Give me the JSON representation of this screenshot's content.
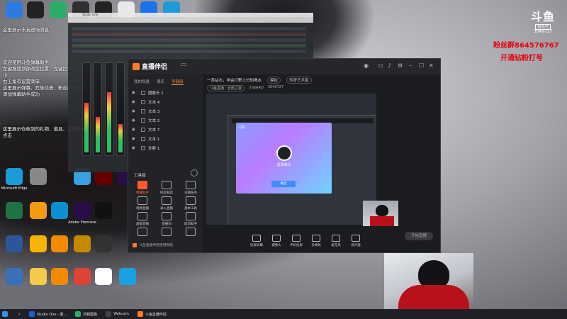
{
  "desktop": {
    "icons": [
      {
        "label": "",
        "icon": "tencent-desktop-icon",
        "color": "#2d7be0"
      },
      {
        "label": "",
        "icon": "audio-meter-icon",
        "color": "#222"
      },
      {
        "label": "",
        "icon": "wechat-icon",
        "color": "#2aae67"
      },
      {
        "label": "",
        "icon": "obs-icon",
        "color": "#303030"
      },
      {
        "label": "",
        "icon": "capcut-icon",
        "color": "#222"
      },
      {
        "label": "",
        "icon": "chrome-icon",
        "color": "#e8e8e8"
      },
      {
        "label": "",
        "icon": "edge-icon",
        "color": "#1a73e8"
      },
      {
        "label": "",
        "icon": "edge-browser-icon",
        "color": "#1d9bd7"
      },
      {
        "label": "Microsoft Edge",
        "icon": "edge-browser-icon",
        "color": "#1d9bd7"
      },
      {
        "label": "",
        "icon": "app-icon",
        "color": "#888"
      },
      {
        "label": "",
        "icon": "app-icon",
        "color": "#3aa0e0"
      },
      {
        "label": "",
        "icon": "app-icon",
        "color": "#600"
      },
      {
        "label": "",
        "icon": "premiere-icon",
        "color": "#2a0c48"
      },
      {
        "label": "",
        "icon": "excel-icon",
        "color": "#1f7244"
      },
      {
        "label": "",
        "icon": "app-icon",
        "color": "#f39c12"
      },
      {
        "label": "",
        "icon": "app-icon",
        "color": "#0a8fd0"
      },
      {
        "label": "Adobe Premiere",
        "icon": "premiere-icon",
        "color": "#2a0c48"
      },
      {
        "label": "",
        "icon": "capcut-icon",
        "color": "#111"
      },
      {
        "label": "",
        "icon": "word-icon",
        "color": "#2b579a"
      },
      {
        "label": "",
        "icon": "app-icon",
        "color": "#f5b400"
      },
      {
        "label": "",
        "icon": "app-icon",
        "color": "#f08a00"
      },
      {
        "label": "",
        "icon": "app-icon",
        "color": "#c58900"
      },
      {
        "label": "",
        "icon": "app-icon",
        "color": "#333"
      },
      {
        "label": "",
        "icon": "computer-icon",
        "color": "#3b6fb6"
      },
      {
        "label": "",
        "icon": "app-icon",
        "color": "#f7c948"
      },
      {
        "label": "",
        "icon": "app-icon",
        "color": "#f08a00"
      },
      {
        "label": "",
        "icon": "app-icon",
        "color": "#d43"
      },
      {
        "label": "",
        "icon": "app-icon",
        "color": "#fff"
      },
      {
        "label": "",
        "icon": "app-icon",
        "color": "#1ba1e2"
      }
    ],
    "notes": [
      "这里展示水友进场消息",
      "欢迎使用斗鱼弹幕助手",
      "左键拖拽顶部改变位置、左键拉伸边框改变大小",
      "右上角有设置菜单",
      "这里展示弹幕、宾族侦查、粉丝牌升级等",
      "添加弹幕助手成功",
      "这里展示你收到的礼物、道具、贵族开通",
      "点击"
    ]
  },
  "overlay_texts": {
    "red_banner": "",
    "yellow_banner": ""
  },
  "douyu": {
    "logo": "斗鱼",
    "room_tag": "房间号",
    "room_id": "3049727",
    "fans_group": "粉丝群864576767",
    "open_fans": "开通钻粉打号"
  },
  "studio_one": {
    "title": "Studio One"
  },
  "companion": {
    "app_name": "直播伴侣",
    "version_badge": "",
    "left_tabs": [
      "我的场景",
      "很乐",
      "可调用"
    ],
    "active_tab_index": 2,
    "layers": [
      "图像头 1",
      "文本 4",
      "文本 3",
      "文本 2",
      "文本 7",
      "文本 1",
      "全屏 1"
    ],
    "toolbox_label": "工具箱",
    "tools": [
      {
        "label": "弹幕助手",
        "icon": "bullet-chat-icon",
        "active": true
      },
      {
        "label": "好友喊话",
        "icon": "user-icon",
        "active": false
      },
      {
        "label": "主播任务",
        "icon": "task-icon",
        "active": false
      },
      {
        "label": "视频直播",
        "icon": "video-icon",
        "active": false
      },
      {
        "label": "录入直播",
        "icon": "download-icon",
        "active": false
      },
      {
        "label": "基本工具",
        "icon": "tool-icon",
        "active": false
      },
      {
        "label": "超级直播",
        "icon": "live-icon",
        "active": false
      },
      {
        "label": "直播间",
        "icon": "room-icon",
        "active": false
      },
      {
        "label": "取消助手",
        "icon": "cancel-icon",
        "active": false
      },
      {
        "label": "",
        "icon": "gift-icon",
        "active": false
      },
      {
        "label": "",
        "icon": "upload-icon",
        "active": false
      },
      {
        "label": "",
        "icon": "more-icon",
        "active": false
      }
    ],
    "tip_text": "斗鱼直播伴侣使用教程",
    "room_title": "一苏站右，学会打野上分知喝水",
    "room_status_pill": "模板",
    "room_category_pill": "传奇艺术家",
    "info_row": [
      "斗鱼直播：云南之夜",
      "小白AAD",
      "3049727"
    ],
    "nested_title": "QQ",
    "qq_name": "登录成功",
    "qq_button": "确定",
    "bottom_buttons": [
      "投屏屏幕",
      "摄像头",
      "手机投屏",
      "多媒体",
      "麦克风",
      "扬声器"
    ],
    "live_button": "开始直播"
  },
  "taskbar": {
    "items": [
      {
        "label": "Studio One - 歌...",
        "color": "#1c5fd1"
      },
      {
        "label": "问我图像",
        "color": "#2aae67"
      },
      {
        "label": "Webcam",
        "color": "#444"
      },
      {
        "label": "斗鱼直播伴侣",
        "color": "#ff7a2e"
      }
    ],
    "time": "",
    "date": ""
  }
}
